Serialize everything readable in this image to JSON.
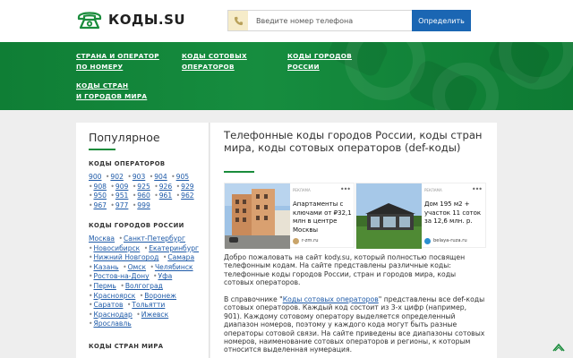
{
  "header": {
    "logo_text": "КОДЫ.SU",
    "search_placeholder": "Введите номер телефона",
    "search_button": "Определить"
  },
  "nav": [
    {
      "label": "СТРАНА И ОПЕРАТОР\nПО НОМЕРУ"
    },
    {
      "label": "КОДЫ СОТОВЫХ\nОПЕРАТОРОВ"
    },
    {
      "label": "КОДЫ ГОРОДОВ\nРОССИИ"
    },
    {
      "label": "КОДЫ СТРАН\nИ ГОРОДОВ МИРА"
    }
  ],
  "sidebar": {
    "title": "Популярное",
    "operators_head": "КОДЫ ОПЕРАТОРОВ",
    "operators": [
      "900",
      "902",
      "903",
      "904",
      "905",
      "908",
      "909",
      "925",
      "926",
      "929",
      "950",
      "951",
      "960",
      "961",
      "962",
      "967",
      "977",
      "999"
    ],
    "cities_head": "КОДЫ ГОРОДОВ РОССИИ",
    "cities": [
      "Москва",
      "Санкт-Петербург",
      "Новосибирск",
      "Екатеринбург",
      "Нижний Новгород",
      "Самара",
      "Казань",
      "Омск",
      "Челябинск",
      "Ростов-на-Дону",
      "Уфа",
      "Пермь",
      "Волгоград",
      "Красноярск",
      "Воронеж",
      "Саратов",
      "Тольятти",
      "Краснодар",
      "Ижевск",
      "Ярославль"
    ],
    "countries_head": "КОДЫ СТРАН МИРА"
  },
  "main": {
    "title": "Телефонные коды городов России, коды стран мира, коды сотовых операторов (def-коды)",
    "ads": [
      {
        "label": "РЕКЛАМА",
        "text": "Апартаменты с ключами от ₽32,1 млн в центре Москвы",
        "source": "r-zm.ru"
      },
      {
        "label": "РЕКЛАМА",
        "text": "Дом 195 м2 + участок 11 соток за 12,6 млн. р.",
        "source": "belaya-ruza.ru"
      }
    ],
    "para1": "Добро пожаловать на сайт kody.su, который полностью посвящен телефонным кодам. На сайте представлены различные коды: телефонные коды городов России, стран и городов мира, коды сотовых операторов.",
    "para2_pre": "В справочнике \"",
    "para2_link": "Коды сотовых операторов",
    "para2_post": "\" представлены все def-коды сотовых операторов. Каждый код состоит из 3-х цифр (например, 901). Каждому сотовому оператору выделяется определенный диапазон номеров, поэтому у каждого кода могут быть разные операторы сотовой связи. На сайте приведены все диапазоны сотовых номеров, наименование сотовых операторов и регионы, к которым относится выделенная нумерация."
  },
  "colors": {
    "brand_green": "#1a8c3c",
    "button_blue": "#1b66b3",
    "link_blue": "#1e5aa8"
  }
}
